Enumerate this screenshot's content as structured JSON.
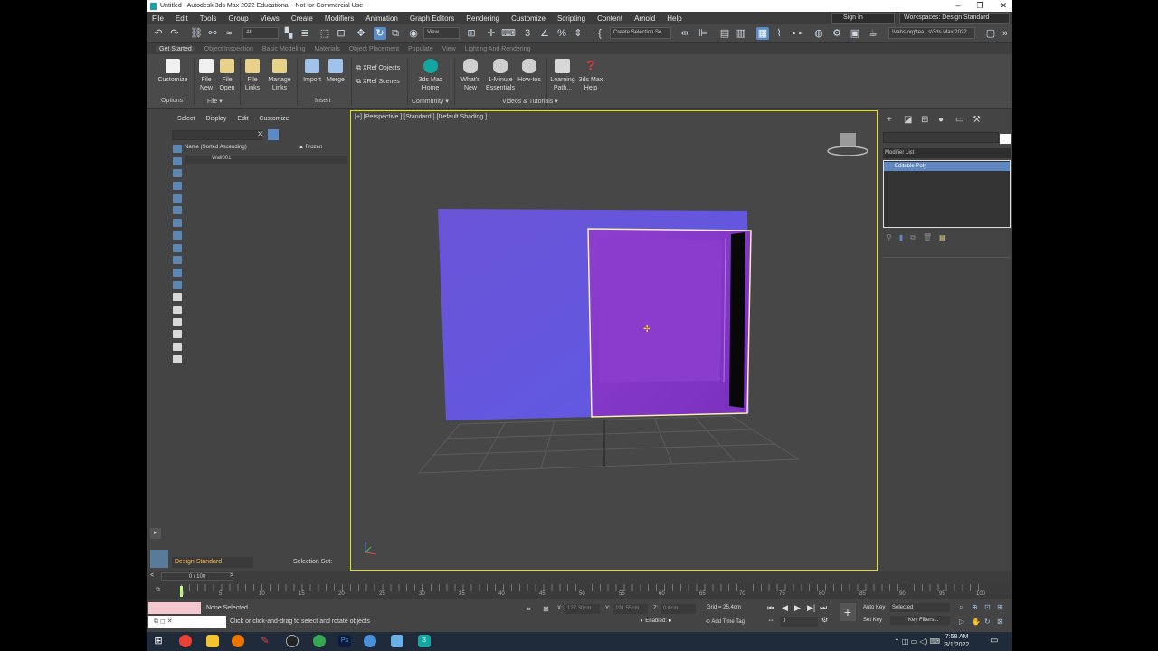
{
  "window": {
    "title": "Untitled - Autodesk 3ds Max 2022 Educational - Not for Commercial Use",
    "minimize": "–",
    "restore": "❐",
    "close": "✕"
  },
  "menu": {
    "items": [
      "File",
      "Edit",
      "Tools",
      "Group",
      "Views",
      "Create",
      "Modifiers",
      "Animation",
      "Graph Editors",
      "Rendering",
      "Customize",
      "Scripting",
      "Content",
      "Arnold",
      "Help"
    ],
    "sign_in": "Sign In",
    "workspaces_label": "Workspaces:",
    "workspace_value": "Design Standard"
  },
  "toolbar": {
    "selection_filter": "All",
    "ref_coord": "View",
    "create_selection_set": "Create Selection Se",
    "path": "\\Vahs.org\\tea...s\\3ds Max 2022"
  },
  "ribbon": {
    "tabs": [
      "Get Started",
      "Object Inspection",
      "Basic Modeling",
      "Materials",
      "Object Placement",
      "Populate",
      "View",
      "Lighting And Rendering"
    ],
    "buttons": {
      "customize": "Customize",
      "file_new": "File New",
      "file_open": "File Open",
      "file_links": "File Links",
      "manage_links": "Manage Links",
      "import": "Import",
      "merge": "Merge",
      "xref_objects": "XRef Objects",
      "xref_scenes": "XRef Scenes",
      "max_home": "3ds Max Home",
      "whats_new": "What's New",
      "one_minute": "1-Minute Essentials",
      "howtos": "How-tos",
      "learning_path": "Learning Path...",
      "max_help": "3ds Max Help"
    },
    "groups": {
      "options": "Options",
      "file": "File",
      "insert": "Insert",
      "community": "Community",
      "videos": "Videos & Tutorials"
    }
  },
  "scene_explorer": {
    "menu": [
      "Select",
      "Display",
      "Edit",
      "Customize"
    ],
    "column_name": "Name (Sorted Ascending)",
    "column_frozen": "Frozen",
    "rows": [
      "Wall001"
    ],
    "workspace": "Design Standard",
    "selection_set_label": "Selection Set:",
    "frame_range": "0 / 100"
  },
  "viewport": {
    "label": "[+] [Perspective ] [Standard ] [Default Shading ]"
  },
  "command_panel": {
    "modifier_list": "Modifier List",
    "stack_items": [
      "Editable Poly"
    ]
  },
  "timeline": {
    "ticks": [
      "0",
      "5",
      "10",
      "15",
      "20",
      "25",
      "30",
      "35",
      "40",
      "45",
      "50",
      "55",
      "60",
      "65",
      "70",
      "75",
      "80",
      "85",
      "90",
      "95",
      "100"
    ]
  },
  "status": {
    "selection": "None Selected",
    "prompt": "Click or click-and-drag to select and rotate objects",
    "x_label": "X:",
    "x_value": "127.30cm",
    "y_label": "Y:",
    "y_value": "191.55cm",
    "z_label": "Z:",
    "z_value": "0.0cm",
    "grid": "Grid = 25.4cm",
    "enabled": "Enabled:",
    "add_time_tag": "Add Time Tag",
    "auto_key": "Auto Key",
    "set_key": "Set Key",
    "selected": "Selected",
    "key_filters": "Key Filters...",
    "frame": "0"
  },
  "taskbar": {
    "time": "7:58 AM",
    "date": "3/1/2022"
  }
}
